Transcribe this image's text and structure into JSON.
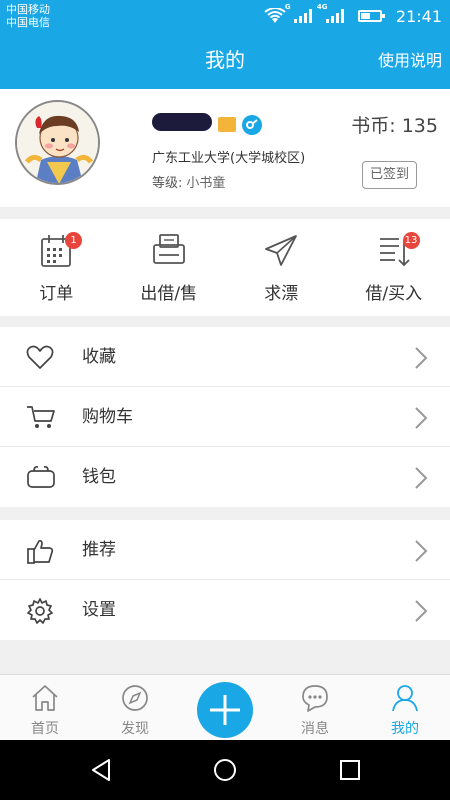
{
  "status_bar": {
    "carrier_1": "中国移动",
    "carrier_2": "中国电信",
    "network_1": "G",
    "network_2": "4G",
    "time": "21:41"
  },
  "header": {
    "title": "我的",
    "help_label": "使用说明"
  },
  "profile": {
    "school": "广东工业大学(大学城校区)",
    "level_label": "等级:",
    "level_value": "小书童",
    "coins": "书币: 135",
    "checkin_label": "已签到"
  },
  "actions": [
    {
      "label": "订单",
      "icon": "calendar-icon",
      "badge": "1"
    },
    {
      "label": "出借/售",
      "icon": "printer-icon",
      "badge": ""
    },
    {
      "label": "求漂",
      "icon": "paper-plane-icon",
      "badge": ""
    },
    {
      "label": "借/买入",
      "icon": "list-download-icon",
      "badge": "13"
    }
  ],
  "menu_group_1": [
    {
      "label": "收藏",
      "icon": "heart-icon"
    },
    {
      "label": "购物车",
      "icon": "cart-icon"
    },
    {
      "label": "钱包",
      "icon": "wallet-icon"
    }
  ],
  "menu_group_2": [
    {
      "label": "推荐",
      "icon": "thumbs-up-icon"
    },
    {
      "label": "设置",
      "icon": "gear-icon"
    }
  ],
  "tabbar": [
    {
      "label": "首页",
      "icon": "home-icon"
    },
    {
      "label": "发现",
      "icon": "compass-icon"
    },
    {
      "label": "消息",
      "icon": "chat-icon"
    },
    {
      "label": "我的",
      "icon": "person-icon",
      "active": true
    }
  ],
  "colors": {
    "accent": "#1aa7e6",
    "badge_red": "#e8453c",
    "chevron": "#999999"
  }
}
